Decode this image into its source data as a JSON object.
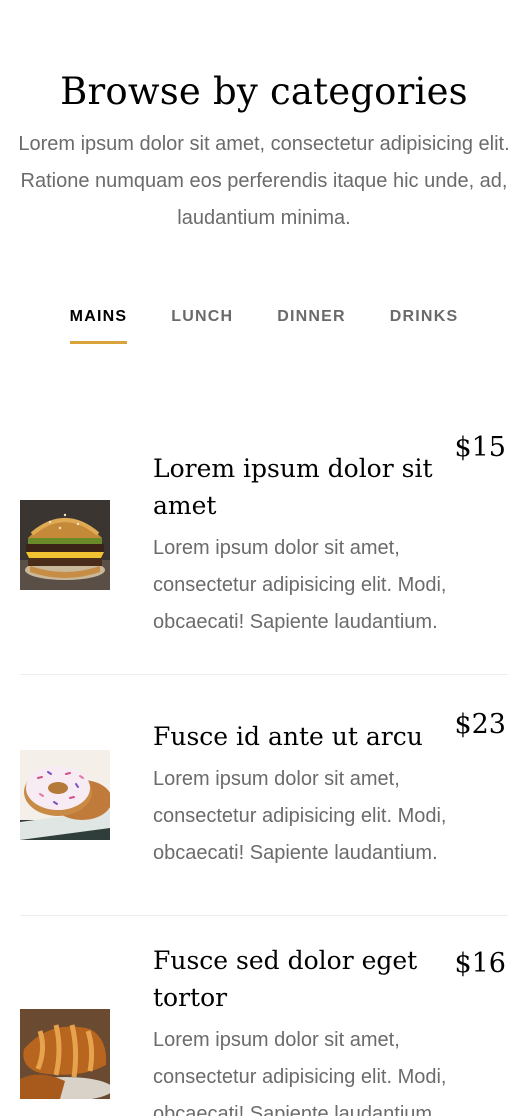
{
  "header": {
    "title": "Browse by categories",
    "intro": "Lorem ipsum dolor sit amet, consectetur adipisicing elit. Ratione numquam eos perferendis itaque hic unde, ad, laudantium minima."
  },
  "tabs": [
    {
      "label": "MAINS",
      "active": true
    },
    {
      "label": "LUNCH",
      "active": false
    },
    {
      "label": "DINNER",
      "active": false
    },
    {
      "label": "DRINKS",
      "active": false
    }
  ],
  "colors": {
    "accent": "#d9a43b",
    "text": "#6b6b6b",
    "heading": "#000000"
  },
  "menu": [
    {
      "title": "Lorem ipsum dolor sit amet",
      "description": "Lorem ipsum dolor sit amet, consectetur adipisicing elit. Modi, obcaecati! Sapiente laudantium.",
      "price": "$15",
      "image": "burger"
    },
    {
      "title": "Fusce id ante ut arcu",
      "description": "Lorem ipsum dolor sit amet, consectetur adipisicing elit. Modi, obcaecati! Sapiente laudantium.",
      "price": "$23",
      "image": "donut"
    },
    {
      "title": "Fusce sed dolor eget tortor",
      "description": "Lorem ipsum dolor sit amet, consectetur adipisicing elit. Modi, obcaecati! Sapiente laudantium.",
      "price": "$16",
      "image": "croissant"
    }
  ]
}
